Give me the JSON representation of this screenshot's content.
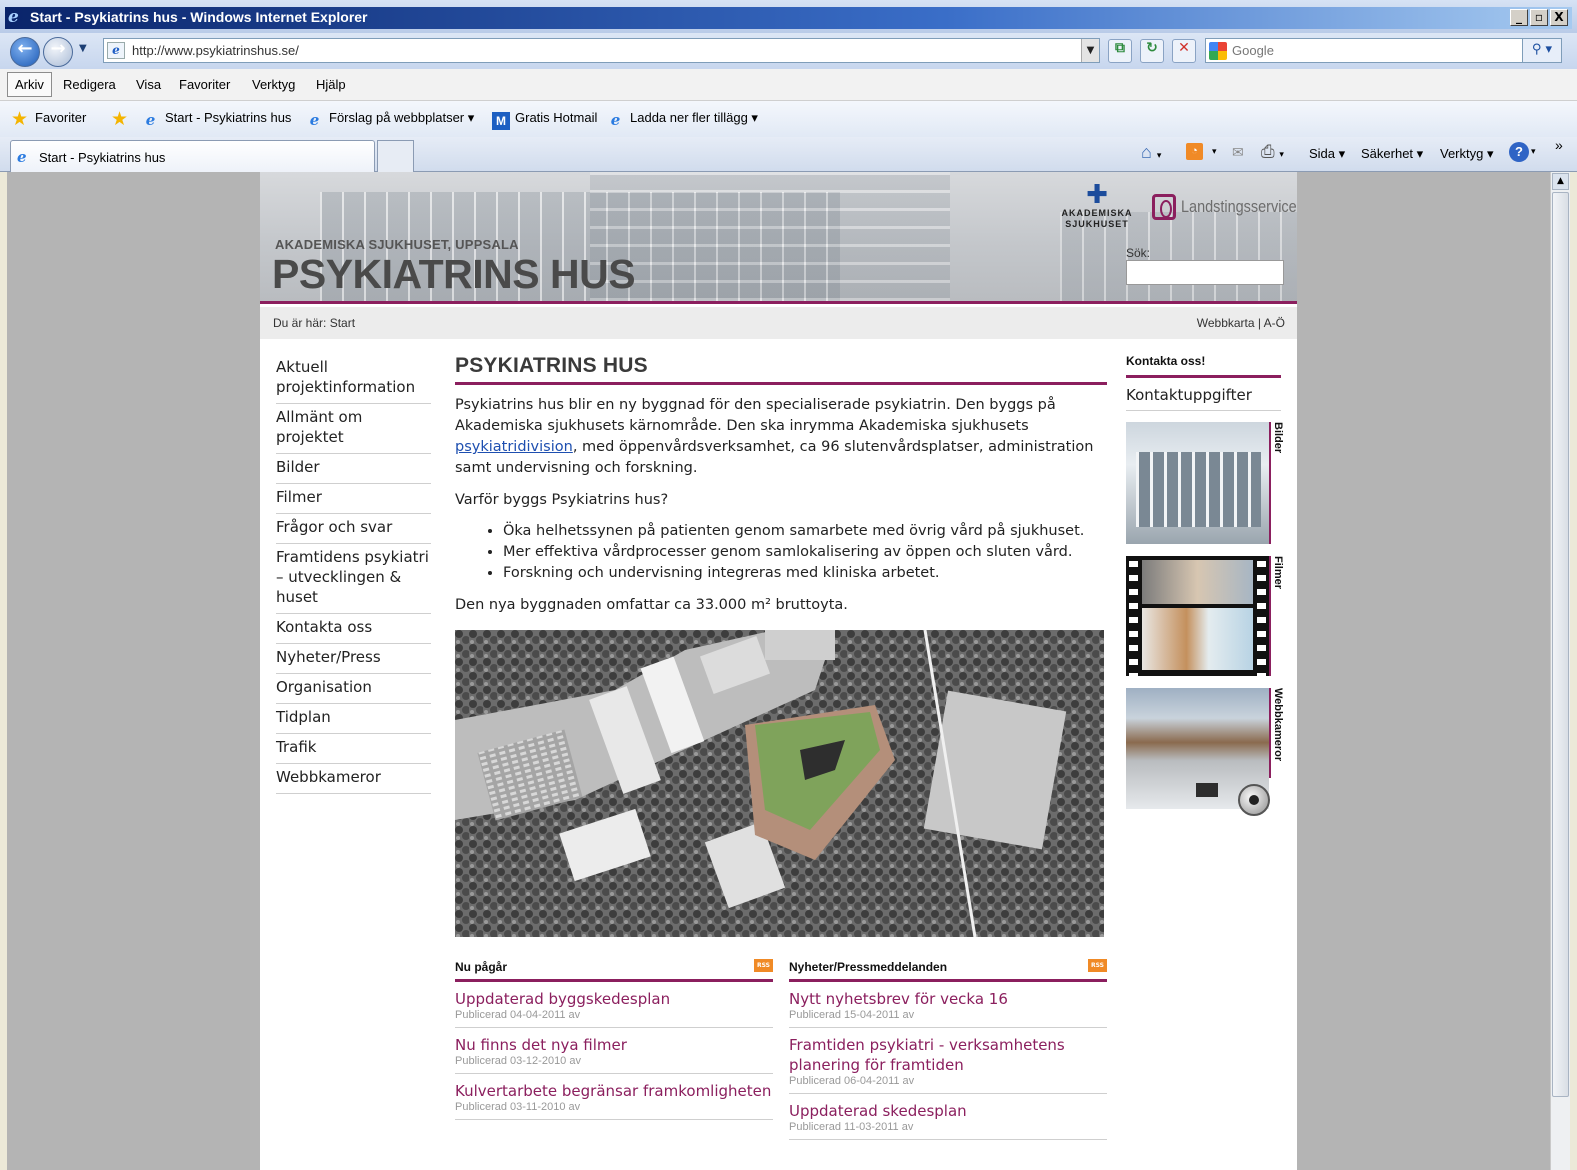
{
  "window": {
    "title": "Start - Psykiatrins hus - Windows Internet Explorer",
    "controls": [
      "_",
      "▫",
      "X"
    ]
  },
  "address": {
    "url": "http://www.psykiatrinshus.se/",
    "search_placeholder": "Google"
  },
  "menu": [
    "Arkiv",
    "Redigera",
    "Visa",
    "Favoriter",
    "Verktyg",
    "Hjälp"
  ],
  "favorites_bar": {
    "favorites_label": "Favoriter",
    "items": [
      "Start - Psykiatrins hus",
      "Förslag på webbplatser ▾",
      "Gratis Hotmail",
      "Ladda ner fler tillägg ▾"
    ]
  },
  "tab": {
    "label": "Start - Psykiatrins hus"
  },
  "command_bar": [
    "Sida ▾",
    "Säkerhet ▾",
    "Verktyg ▾"
  ],
  "page": {
    "header": {
      "subtitle": "AKADEMISKA SJUKHUSET, UPPSALA",
      "title": "PSYKIATRINS HUS",
      "logo1_line1": "AKADEMISKA",
      "logo1_line2": "SJUKHUSET",
      "logo2": "Landstingsservice",
      "search_label": "Sök:"
    },
    "breadcrumb": "Du är här: Start",
    "toplinks": "Webbkarta | A-Ö",
    "left_nav": [
      "Aktuell projektinformation",
      "Allmänt om projektet",
      "Bilder",
      "Filmer",
      "Frågor och svar",
      "Framtidens psykiatri – utvecklingen & huset",
      "Kontakta oss",
      "Nyheter/Press",
      "Organisation",
      "Tidplan",
      "Trafik",
      "Webbkameror"
    ],
    "main": {
      "title": "PSYKIATRINS HUS",
      "intro_before": "Psykiatrins hus blir en ny byggnad för den specialiserade psykiatrin. Den byggs på Akademiska sjukhusets kärnområde. Den ska inrymma Akademiska sjukhusets ",
      "intro_link": "psykiatridivision",
      "intro_after": ", med öppenvårdsverksamhet, ca 96 slutenvårdsplatser, administration samt undervisning och forskning.",
      "question": "Varför byggs Psykiatrins hus?",
      "bullets": [
        "Öka helhetssynen på patienten genom samarbete med övrig vård på sjukhuset.",
        "Mer effektiva vårdprocesser genom samlokalisering av öppen och sluten vård.",
        "Forskning och undervisning integreras med kliniska arbetet."
      ],
      "size_line": "Den nya byggnaden omfattar ca 33.000 m² bruttoyta."
    },
    "news_now": {
      "heading": "Nu pågår",
      "items": [
        {
          "title": "Uppdaterad byggskedesplan",
          "date": "Publicerad 04-04-2011 av"
        },
        {
          "title": "Nu finns det nya filmer",
          "date": "Publicerad 03-12-2010 av"
        },
        {
          "title": "Kulvertarbete begränsar framkomligheten",
          "date": "Publicerad 03-11-2010 av"
        }
      ]
    },
    "news_press": {
      "heading": "Nyheter/Pressmeddelanden",
      "items": [
        {
          "title": "Nytt nyhetsbrev för vecka 16",
          "date": "Publicerad 15-04-2011 av"
        },
        {
          "title": "Framtiden psykiatri - verksamhetens planering för framtiden",
          "date": "Publicerad 06-04-2011 av"
        },
        {
          "title": "Uppdaterad skedesplan",
          "date": "Publicerad 11-03-2011 av"
        }
      ]
    },
    "right": {
      "contact_heading": "Kontakta oss!",
      "contact_link": "Kontaktuppgifter",
      "promos": [
        "Bilder",
        "Filmer",
        "Webbkameror"
      ]
    },
    "rss_label": "RSS",
    "colors": {
      "accent": "#8b1f5e",
      "link": "#1e4fb0"
    }
  }
}
